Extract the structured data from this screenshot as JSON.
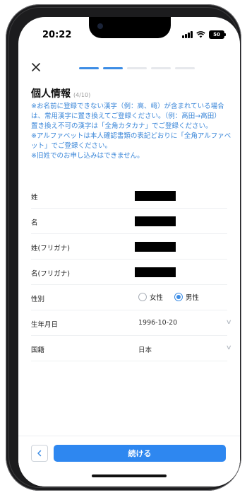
{
  "status": {
    "time": "20:22",
    "battery": "50",
    "icons": [
      "signal-icon",
      "wifi-icon",
      "battery-icon"
    ]
  },
  "header": {
    "close_icon": "close-icon",
    "progress": {
      "total": 5,
      "completed": 2
    }
  },
  "page": {
    "title": "個人情報",
    "step": "(4/10)",
    "notice": [
      "※お名前に登録できない漢字（例：高、﨑）が含まれている場合は、常用漢字に置き換えてご登録ください。（例：髙田→高田）",
      "置き換え不可の漢字は「全角カタカナ」でご登録ください。",
      "※アルファベットは本人確認書類の表記どおりに「全角アルファベット」でご登録ください。",
      "※旧姓でのお申し込みはできません。"
    ]
  },
  "form": {
    "last_name": {
      "label": "姓"
    },
    "first_name": {
      "label": "名"
    },
    "last_name_kana": {
      "label": "姓(フリガナ)"
    },
    "first_name_kana": {
      "label": "名(フリガナ)"
    },
    "gender": {
      "label": "性別",
      "options": [
        "女性",
        "男性"
      ],
      "selected": "男性"
    },
    "birthdate": {
      "label": "生年月日",
      "value": "1996-10-20"
    },
    "nationality": {
      "label": "国籍",
      "value": "日本"
    }
  },
  "footer": {
    "back_icon": "chevron-left-icon",
    "continue_label": "続ける"
  },
  "colors": {
    "accent": "#2e87f0",
    "notice_text": "#3a86d8",
    "progress_on": "#3d8de5",
    "progress_off": "#e6e8ec"
  }
}
